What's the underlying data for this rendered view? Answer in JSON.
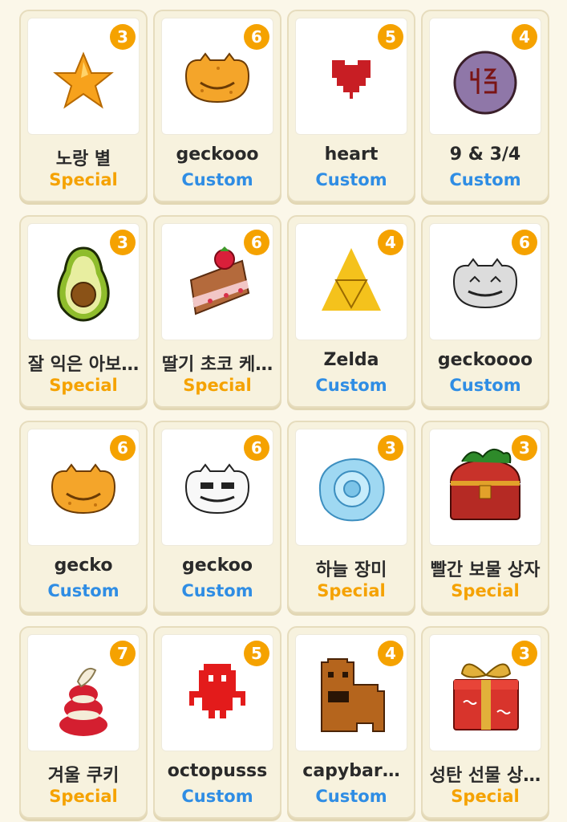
{
  "colors": {
    "badge": "#f5a200",
    "special": "#f5a200",
    "custom": "#2f8de4",
    "card_bg": "#f7f2de"
  },
  "items": [
    {
      "name": "노랑 별",
      "type": "Special",
      "count": "3",
      "icon": "star-icon"
    },
    {
      "name": "geckooo",
      "type": "Custom",
      "count": "6",
      "icon": "orange-gecko-icon"
    },
    {
      "name": "heart",
      "type": "Custom",
      "count": "5",
      "icon": "heart-icon"
    },
    {
      "name": "9 & 3/4",
      "type": "Custom",
      "count": "4",
      "icon": "platform-sign-icon"
    },
    {
      "name": "잘 익은 아보…",
      "type": "Special",
      "count": "3",
      "icon": "avocado-icon"
    },
    {
      "name": "딸기 초코 케…",
      "type": "Special",
      "count": "6",
      "icon": "cake-icon"
    },
    {
      "name": "Zelda",
      "type": "Custom",
      "count": "4",
      "icon": "triforce-icon"
    },
    {
      "name": "geckoooo",
      "type": "Custom",
      "count": "6",
      "icon": "grey-gecko-icon"
    },
    {
      "name": "gecko",
      "type": "Custom",
      "count": "6",
      "icon": "orange-gecko-icon"
    },
    {
      "name": "geckoo",
      "type": "Custom",
      "count": "6",
      "icon": "white-gecko-icon"
    },
    {
      "name": "하늘 장미",
      "type": "Special",
      "count": "3",
      "icon": "blue-rose-icon"
    },
    {
      "name": "빨간 보물 상자",
      "type": "Special",
      "count": "3",
      "icon": "treasure-chest-icon"
    },
    {
      "name": "겨울 쿠키",
      "type": "Special",
      "count": "7",
      "icon": "winter-cookie-icon"
    },
    {
      "name": "octopusss",
      "type": "Custom",
      "count": "5",
      "icon": "octopus-icon"
    },
    {
      "name": "capybar…",
      "type": "Custom",
      "count": "4",
      "icon": "capybara-icon"
    },
    {
      "name": "성탄 선물 상…",
      "type": "Special",
      "count": "3",
      "icon": "gift-box-icon"
    }
  ]
}
